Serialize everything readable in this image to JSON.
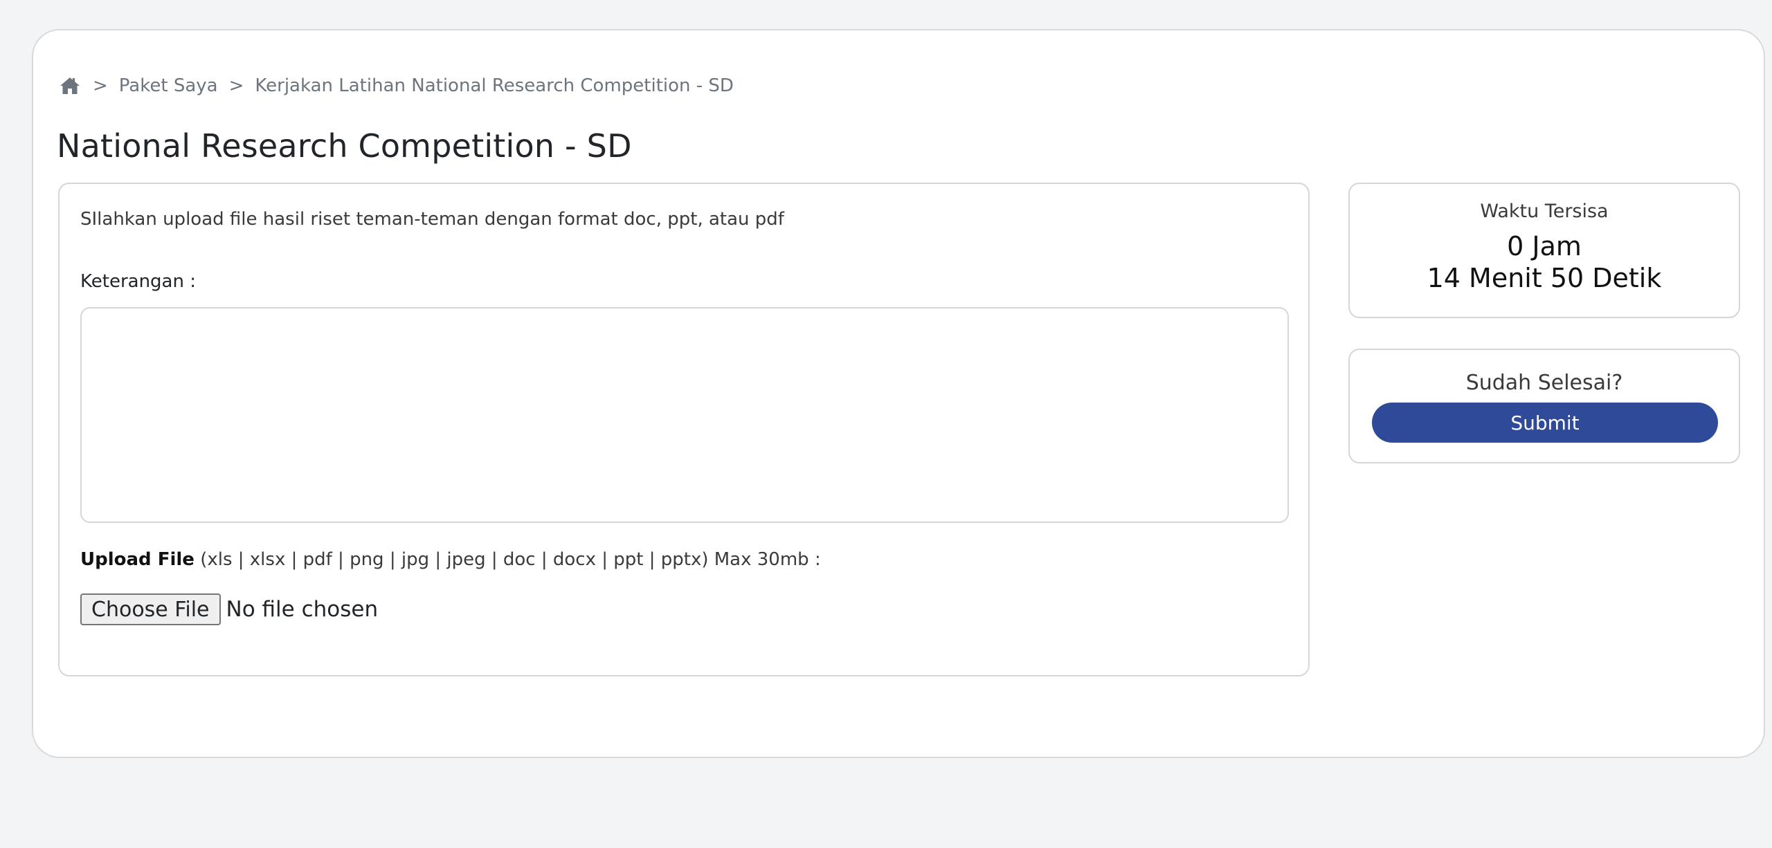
{
  "breadcrumb": {
    "home_icon": "home-icon",
    "separator": ">",
    "items": [
      "Paket Saya",
      "Kerjakan Latihan National Research Competition - SD"
    ]
  },
  "page": {
    "title": "National Research Competition - SD"
  },
  "form": {
    "instruction": "SIlahkan upload file hasil riset teman-teman dengan format doc, ppt, atau pdf",
    "keterangan_label": "Keterangan :",
    "keterangan_value": "",
    "upload_label_bold": "Upload File",
    "upload_label_rest": " (xls | xlsx | pdf | png | jpg | jpeg | doc | docx | ppt | pptx) Max 30mb :",
    "choose_file_label": "Choose File",
    "no_file_text": "No file chosen"
  },
  "timer": {
    "label": "Waktu Tersisa",
    "hours": "0 Jam",
    "minutes_seconds": "14 Menit 50 Detik"
  },
  "submit": {
    "question": "Sudah Selesai?",
    "button_label": "Submit"
  },
  "colors": {
    "page_background": "#f3f4f6",
    "submit_button": "#2f4a98",
    "border": "#d6d6d6"
  }
}
